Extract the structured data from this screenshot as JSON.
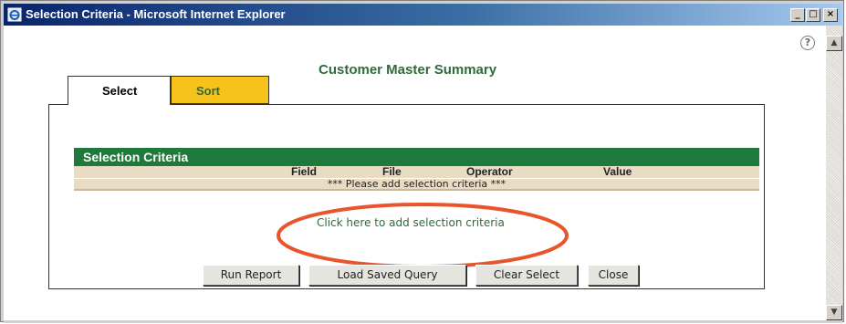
{
  "window": {
    "title": "Selection Criteria - Microsoft Internet Explorer",
    "minimize_label": "_",
    "maximize_label": "□",
    "close_label": "×"
  },
  "page": {
    "help_label": "?",
    "title": "Customer Master Summary"
  },
  "tabs": [
    {
      "label": "Select",
      "active": true
    },
    {
      "label": "Sort",
      "active": false
    }
  ],
  "criteria": {
    "heading": "Selection Criteria",
    "columns": [
      "Field",
      "File",
      "Operator",
      "Value"
    ],
    "empty_message": "*** Please add selection criteria ***",
    "add_link": "Click here to add selection criteria"
  },
  "buttons": {
    "run": "Run Report",
    "load": "Load Saved Query",
    "clear": "Clear Select",
    "close": "Close"
  },
  "scrollbar": {
    "up_label": "▲",
    "down_label": "▼"
  },
  "colors": {
    "header_green": "#1e7a3a",
    "title_green": "#2e6b39",
    "sort_tab": "#f7c21c",
    "highlight": "#e8552b"
  }
}
